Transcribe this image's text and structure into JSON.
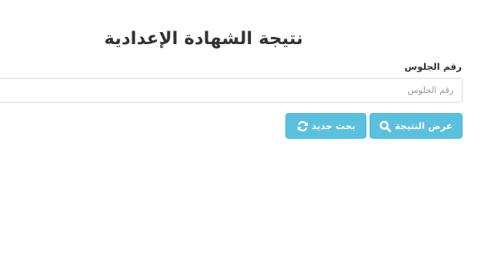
{
  "page": {
    "title": "نتيجة الشهادة الإعدادية"
  },
  "form": {
    "seat_label": "رقم الجلوس",
    "seat_placeholder": "رقم الجلوس",
    "seat_value": ""
  },
  "actions": {
    "show_result_label": "عرض النتيجة",
    "show_result_icon": "search-icon",
    "new_search_label": "بحث جديد",
    "new_search_icon": "refresh-icon"
  },
  "colors": {
    "button_bg": "#5bc0de",
    "button_border": "#46b8da",
    "title_text": "#333333"
  }
}
